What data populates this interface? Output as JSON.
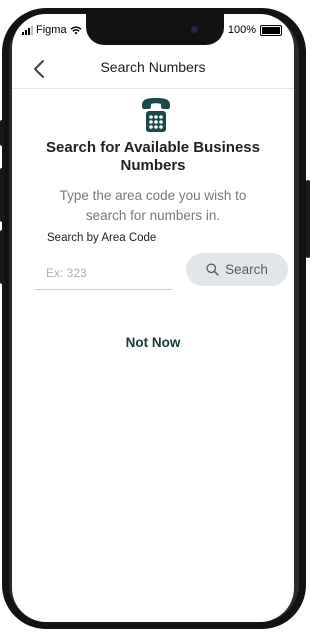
{
  "status_bar": {
    "carrier": "Figma",
    "battery_text": "100%"
  },
  "nav": {
    "title": "Search Numbers"
  },
  "main": {
    "heading": "Search for Available Business Numbers",
    "subtitle": "Type the area code you wish to search for numbers in.",
    "field_label": "Search by Area Code",
    "input": {
      "placeholder": "Ex: 323",
      "value": ""
    },
    "search_label": "Search",
    "not_now_label": "Not Now"
  },
  "colors": {
    "accent": "#1a4a4a",
    "button_bg": "#e3e6e8"
  },
  "icons": [
    "back-chevron-icon",
    "telephone-icon",
    "search-icon",
    "wifi-icon",
    "bluetooth-icon",
    "battery-icon"
  ]
}
